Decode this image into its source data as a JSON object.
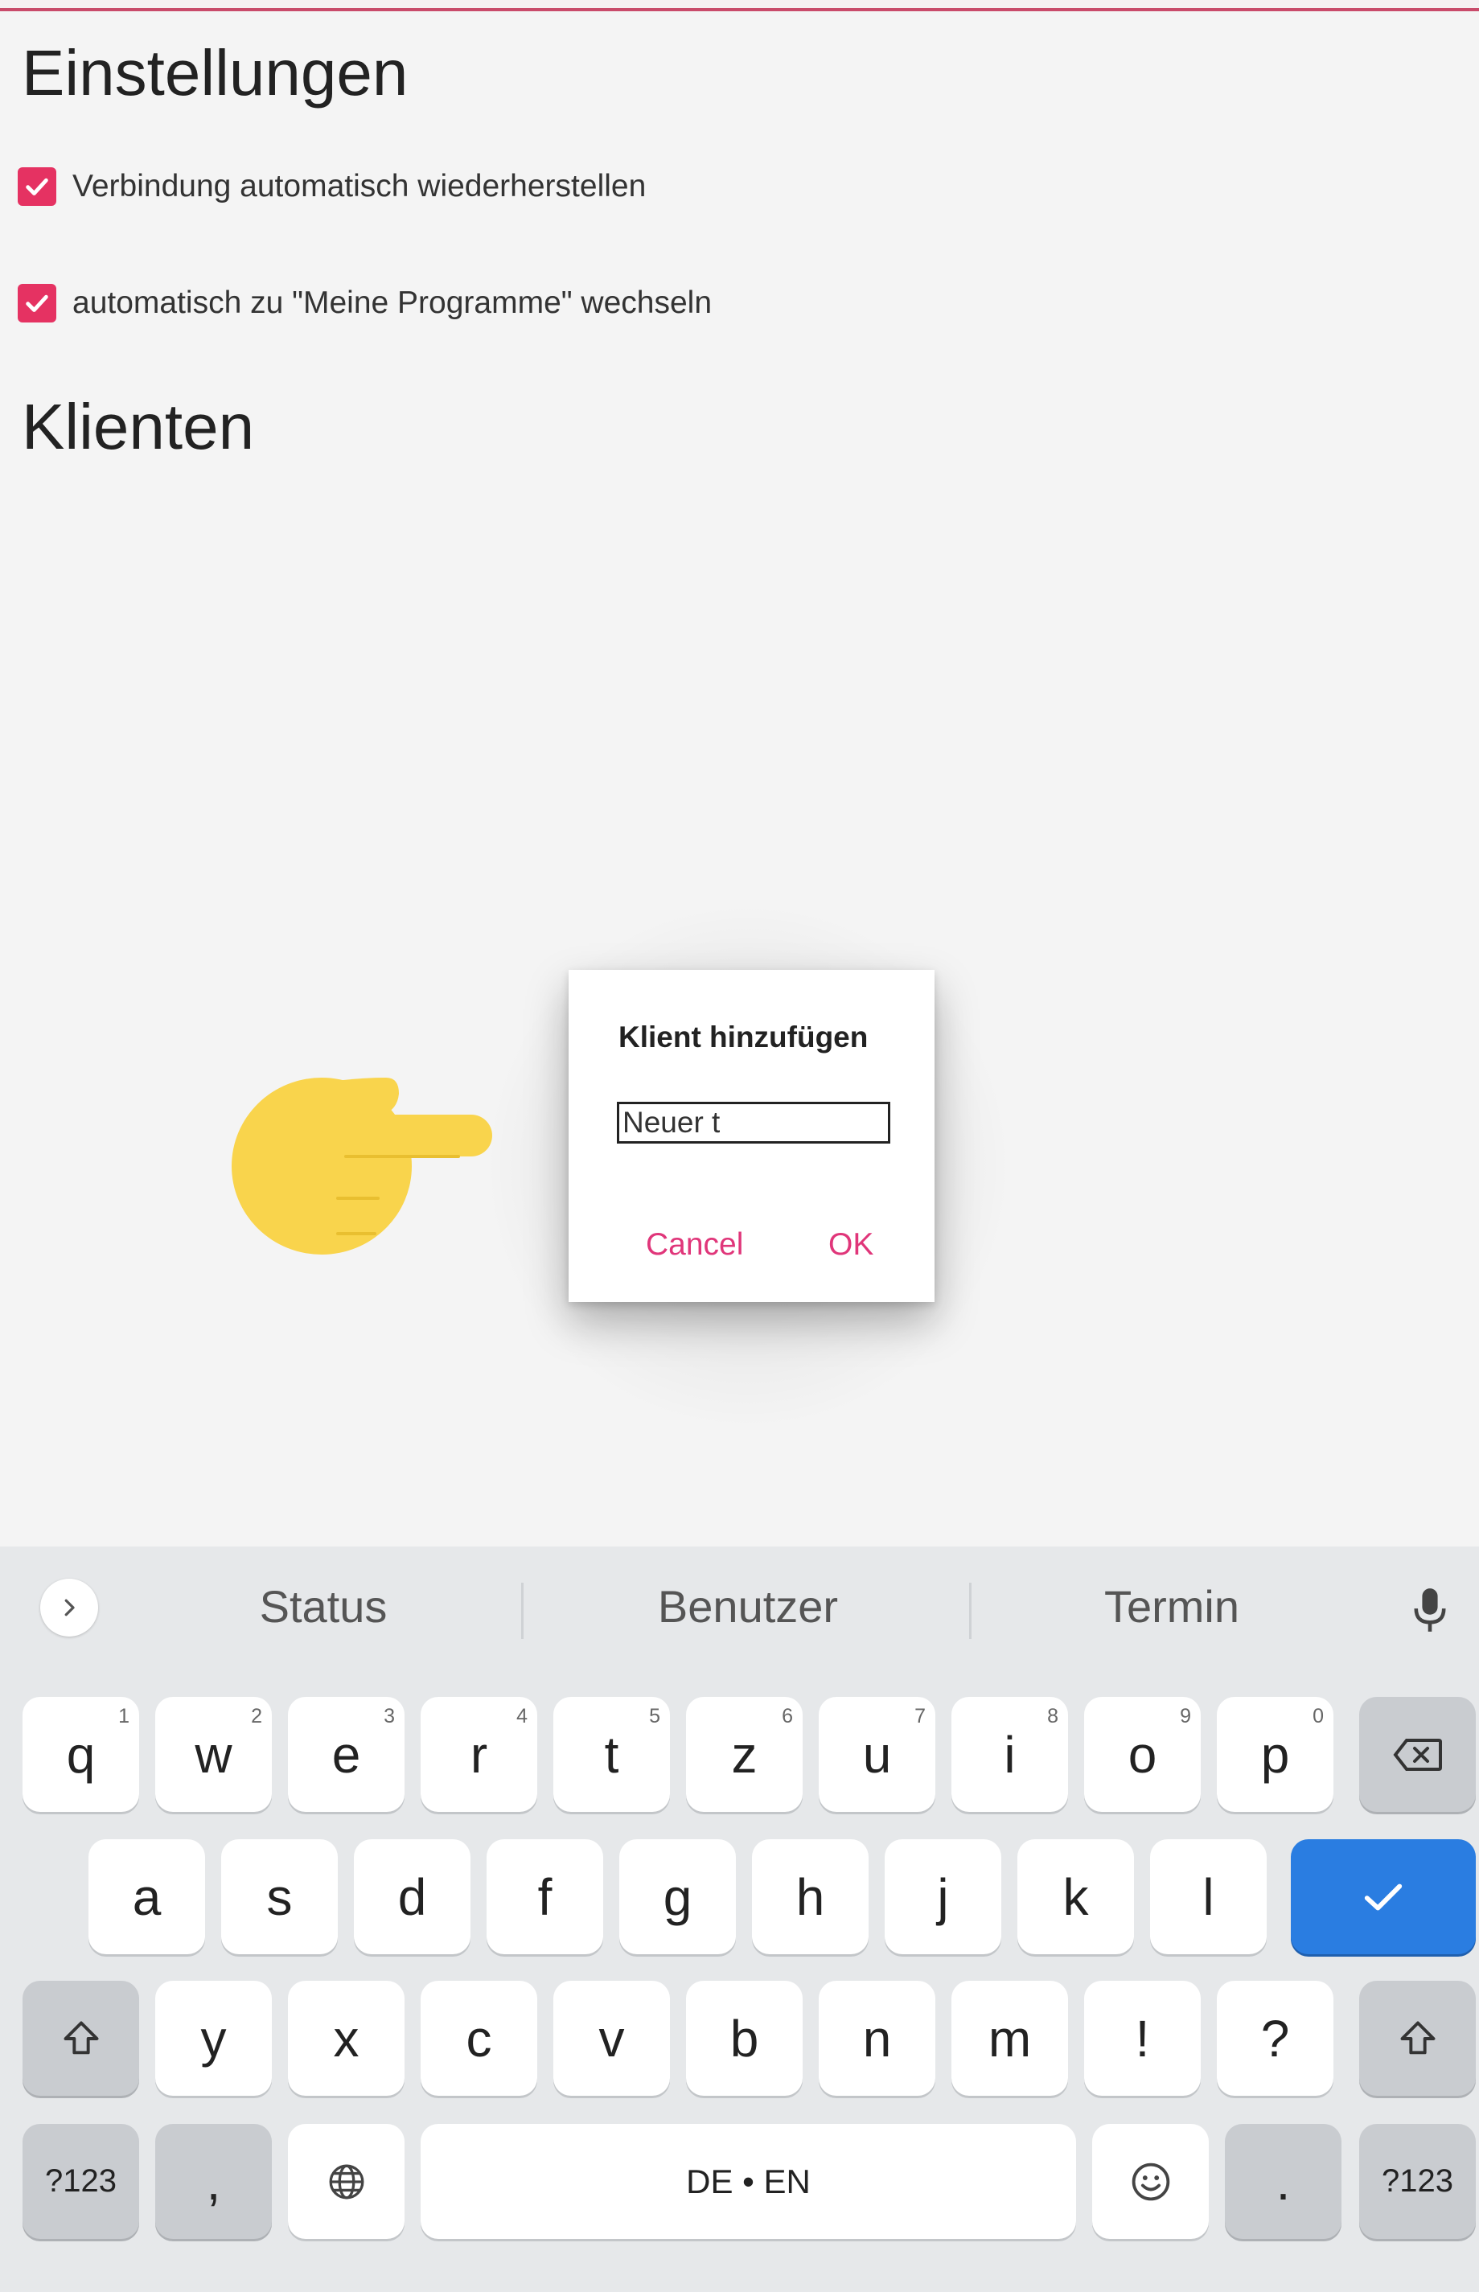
{
  "settings": {
    "title": "Einstellungen",
    "options": [
      {
        "label": "Verbindung automatisch wiederherstellen",
        "checked": true
      },
      {
        "label": "automatisch zu \"Meine Programme\" wechseln",
        "checked": true
      }
    ]
  },
  "clients": {
    "title": "Klienten"
  },
  "dialog": {
    "title": "Klient hinzufügen",
    "input_value": "Neuer t",
    "cancel_label": "Cancel",
    "ok_label": "OK"
  },
  "keyboard": {
    "suggestions": [
      "Status",
      "Benutzer",
      "Termin"
    ],
    "row1": [
      {
        "k": "q",
        "h": "1"
      },
      {
        "k": "w",
        "h": "2"
      },
      {
        "k": "e",
        "h": "3"
      },
      {
        "k": "r",
        "h": "4"
      },
      {
        "k": "t",
        "h": "5"
      },
      {
        "k": "z",
        "h": "6"
      },
      {
        "k": "u",
        "h": "7"
      },
      {
        "k": "i",
        "h": "8"
      },
      {
        "k": "o",
        "h": "9"
      },
      {
        "k": "p",
        "h": "0"
      }
    ],
    "row2": [
      "a",
      "s",
      "d",
      "f",
      "g",
      "h",
      "j",
      "k",
      "l"
    ],
    "row3": [
      "y",
      "x",
      "c",
      "v",
      "b",
      "n",
      "m",
      "!",
      "?"
    ],
    "symbols_label": "?123",
    "comma_label": ",",
    "space_label": "DE • EN",
    "period_label": "."
  },
  "colors": {
    "accent": "#e53262",
    "dialog_button": "#e0367a",
    "enter_key": "#2a7de1",
    "hand": "#f9d44c"
  },
  "icons": [
    "checkbox-checked-icon",
    "pointing-hand-icon",
    "chevron-right-icon",
    "microphone-icon",
    "backspace-icon",
    "checkmark-icon",
    "shift-icon",
    "globe-icon",
    "emoji-icon"
  ]
}
